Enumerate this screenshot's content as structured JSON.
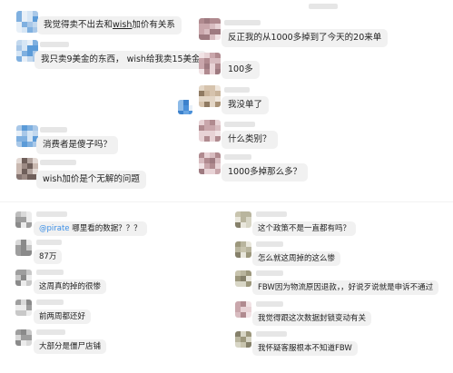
{
  "colors": {
    "bubble": "#f1f1f1",
    "text": "#222222",
    "mention": "#3a8ee6",
    "blue_avatar": "#4a90d9"
  },
  "top_left": [
    {
      "text": "我觉得卖不出去和wish加价有关系",
      "avatar": "blue"
    },
    {
      "text": "我只卖9美金的东西， wish给我卖15美金",
      "avatar": "blue"
    },
    {
      "text": "消费者是傻子吗？",
      "avatar": "blue"
    },
    {
      "text": "wish加价是个无解的问题",
      "avatar": "brown"
    }
  ],
  "top_right": [
    {
      "text": "反正我的从1000多掉到了今天的20来单",
      "avatar": "pink"
    },
    {
      "text": "100多",
      "avatar": "pink"
    },
    {
      "text": "我没单了",
      "avatar": "tan"
    },
    {
      "text": "什么类别？",
      "avatar": "pink"
    },
    {
      "text": "1000多掉那么多？",
      "avatar": "pink"
    }
  ],
  "bottom_left": [
    {
      "mention": "@pirate",
      "text": " 哪里看的数据？？？",
      "avatar": "gray"
    },
    {
      "text": "87万",
      "avatar": "gray"
    },
    {
      "text": "这周真的掉的很惨",
      "avatar": "gray"
    },
    {
      "text": "前两周都还好",
      "avatar": "gray"
    },
    {
      "text": "大部分是僵尸店铺",
      "avatar": "gray"
    }
  ],
  "bottom_right": [
    {
      "text": "这个政策不是一直都有吗？",
      "avatar": "olive"
    },
    {
      "text": "怎么就这周掉的这么惨",
      "avatar": "olive"
    },
    {
      "text": "FBW因为物流原因退款，，好说歹说就是申诉不通过",
      "avatar": "olive"
    },
    {
      "text": "我觉得跟这次数据封锁变动有关",
      "avatar": "pink"
    },
    {
      "text": "我怀疑客服根本不知道FBW",
      "avatar": "olive"
    }
  ]
}
